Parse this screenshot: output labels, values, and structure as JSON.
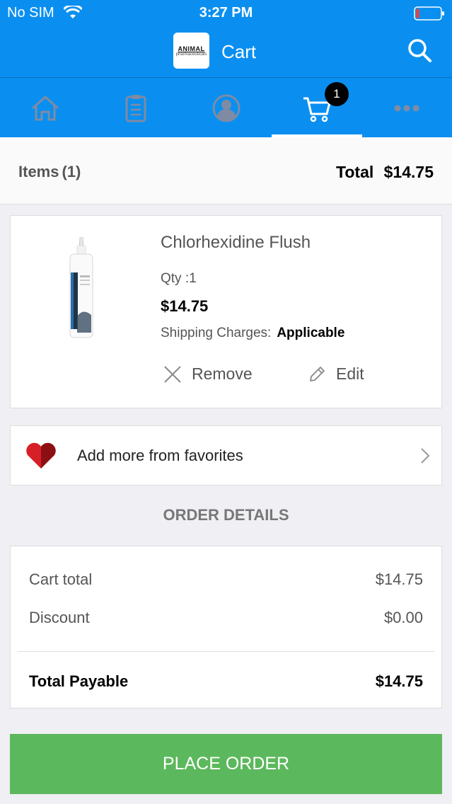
{
  "status_bar": {
    "carrier": "No SIM",
    "time": "3:27 PM"
  },
  "navbar": {
    "logo_line1": "ANIMAL",
    "logo_line2": "pharmaceuticals",
    "title": "Cart"
  },
  "tabs": [
    {
      "name": "home",
      "icon": "home-icon"
    },
    {
      "name": "orders",
      "icon": "clipboard-icon"
    },
    {
      "name": "account",
      "icon": "user-icon"
    },
    {
      "name": "cart",
      "icon": "cart-icon",
      "badge": "1",
      "active": true
    },
    {
      "name": "more",
      "icon": "more-icon"
    }
  ],
  "cart_header": {
    "items_label": "Items",
    "items_count": "(1)",
    "total_label": "Total",
    "total_value": "$14.75"
  },
  "product": {
    "name": "Chlorhexidine Flush",
    "qty_label": "Qty :",
    "qty_value": "1",
    "price": "$14.75",
    "shipping_label": "Shipping Charges:",
    "shipping_value": "Applicable",
    "remove_label": "Remove",
    "edit_label": "Edit"
  },
  "favorites": {
    "label": "Add more from favorites"
  },
  "order_details": {
    "heading": "ORDER DETAILS",
    "cart_total_label": "Cart total",
    "cart_total_value": "$14.75",
    "discount_label": "Discount",
    "discount_value": "$0.00",
    "payable_label": "Total Payable",
    "payable_value": "$14.75"
  },
  "place_order_label": "PLACE ORDER",
  "colors": {
    "brand_blue": "#0a8ff0",
    "place_order_green": "#5cb85c",
    "badge_black": "#000000",
    "heart_red": "#c8102e"
  }
}
